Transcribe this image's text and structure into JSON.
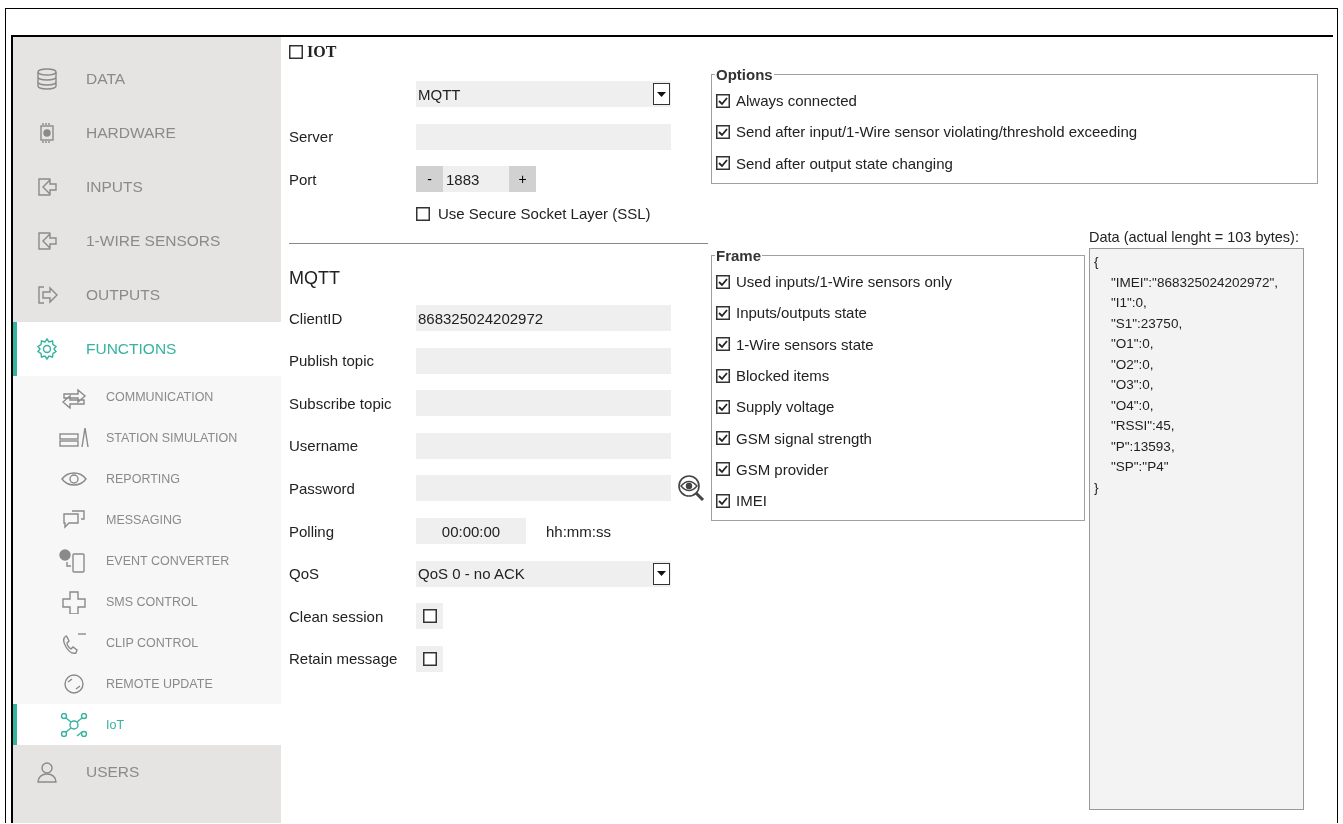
{
  "sidebar": {
    "items": [
      {
        "label": "DATA",
        "selected": false
      },
      {
        "label": "HARDWARE",
        "selected": false
      },
      {
        "label": "INPUTS",
        "selected": false
      },
      {
        "label": "1-WIRE SENSORS",
        "selected": false
      },
      {
        "label": "OUTPUTS",
        "selected": false
      },
      {
        "label": "FUNCTIONS",
        "selected": true,
        "children": [
          {
            "label": "COMMUNICATION",
            "selected": false
          },
          {
            "label": "STATION SIMULATION",
            "selected": false
          },
          {
            "label": "REPORTING",
            "selected": false
          },
          {
            "label": "MESSAGING",
            "selected": false
          },
          {
            "label": "EVENT CONVERTER",
            "selected": false
          },
          {
            "label": "SMS CONTROL",
            "selected": false
          },
          {
            "label": "CLIP CONTROL",
            "selected": false
          },
          {
            "label": "REMOTE UPDATE",
            "selected": false
          },
          {
            "label": "IoT",
            "selected": true
          }
        ]
      },
      {
        "label": "USERS",
        "selected": false
      }
    ]
  },
  "iot": {
    "label": "IOT",
    "checked": false
  },
  "form": {
    "rows": [
      {
        "kind": "select",
        "value": "MQTT"
      },
      {
        "kind": "text",
        "label": "Server"
      },
      {
        "kind": "spinner",
        "label": "Port",
        "value": "1883",
        "minus": "-",
        "plus": "+"
      },
      {
        "kind": "option",
        "text": "Use Secure Socket Layer (SSL)",
        "checked": false
      },
      {
        "kind": "divider"
      },
      {
        "kind": "heading",
        "text": "MQTT"
      },
      {
        "kind": "text",
        "label": "ClientID",
        "value": "868325024202972"
      },
      {
        "kind": "text",
        "label": "Publish topic"
      },
      {
        "kind": "text",
        "label": "Subscribe topic"
      },
      {
        "kind": "text",
        "label": "Username"
      },
      {
        "kind": "password",
        "label": "Password"
      },
      {
        "kind": "time",
        "label": "Polling",
        "value": "00:00:00",
        "unit": "hh:mm:ss"
      },
      {
        "kind": "select",
        "label": "QoS",
        "value": "QoS 0 - no ACK"
      },
      {
        "kind": "check",
        "label": "Clean session",
        "checked": false
      },
      {
        "kind": "check",
        "label": "Retain message",
        "checked": false
      }
    ]
  },
  "options": {
    "title": "Options",
    "items": [
      {
        "label": "Always connected",
        "checked": true
      },
      {
        "label": "Send after input/1-Wire sensor violating/threshold exceeding",
        "checked": true
      },
      {
        "label": "Send after output state changing",
        "checked": true
      }
    ]
  },
  "frame": {
    "title": "Frame",
    "items": [
      {
        "label": "Used inputs/1-Wire sensors only",
        "checked": true
      },
      {
        "label": "Inputs/outputs state",
        "checked": true
      },
      {
        "label": "1-Wire sensors state",
        "checked": true
      },
      {
        "label": "Blocked items",
        "checked": true
      },
      {
        "label": "Supply voltage",
        "checked": true
      },
      {
        "label": "GSM signal strength",
        "checked": true
      },
      {
        "label": "GSM provider",
        "checked": true
      },
      {
        "label": "IMEI",
        "checked": true
      }
    ]
  },
  "data_preview": {
    "label": "Data (actual lenght = 103 bytes):",
    "open": "{",
    "entries": [
      "\"IMEI\":\"868325024202972\",",
      "\"I1\":0,",
      "\"S1\":23750,",
      "\"O1\":0,",
      "\"O2\":0,",
      "\"O3\":0,",
      "\"O4\":0,",
      "\"RSSI\":45,",
      "\"P\":13593,",
      "\"SP\":\"P4\""
    ],
    "close": "}"
  }
}
